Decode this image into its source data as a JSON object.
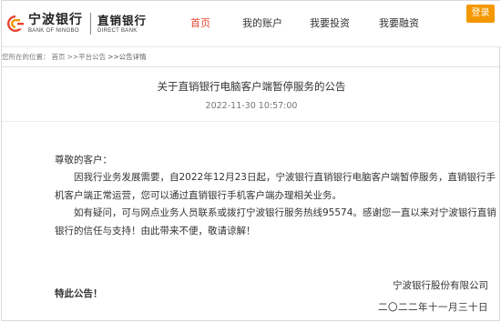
{
  "brand": {
    "name_cn": "宁波银行",
    "name_en": "BANK OF NINGBO",
    "sub_cn": "直销银行",
    "sub_en": "DIRECT BANK",
    "accent": "#e8452f",
    "login_color": "#f39800"
  },
  "nav": {
    "items": [
      {
        "label": "首页",
        "active": true
      },
      {
        "label": "我的账户",
        "active": false
      },
      {
        "label": "我要投资",
        "active": false
      },
      {
        "label": "我要融资",
        "active": false
      }
    ],
    "login_label": "登录"
  },
  "breadcrumb": {
    "prefix": "您所在的位置：",
    "items": [
      "首页",
      ">>平台公告",
      ">>公告详情"
    ]
  },
  "article": {
    "title": "关于直销银行电脑客户端暂停服务的公告",
    "date": "2022-11-30 10:57:00",
    "greeting": "尊敬的客户：",
    "paragraph1": "因我行业务发展需要，自2022年12月23日起，宁波银行直销银行电脑客户端暂停服务，直销银行手机客户端正常运营，您可以通过直销银行手机客户端办理相关业务。",
    "paragraph2": "如有疑问，可与网点业务人员联系或拨打宁波银行服务热线95574。感谢您一直以来对宁波银行直销银行的信任与支持！由此带来不便，敬请谅解！",
    "notice": "特此公告！",
    "signature_company": "宁波银行股份有限公司",
    "signature_date": "二〇二二年十一月三十日"
  }
}
